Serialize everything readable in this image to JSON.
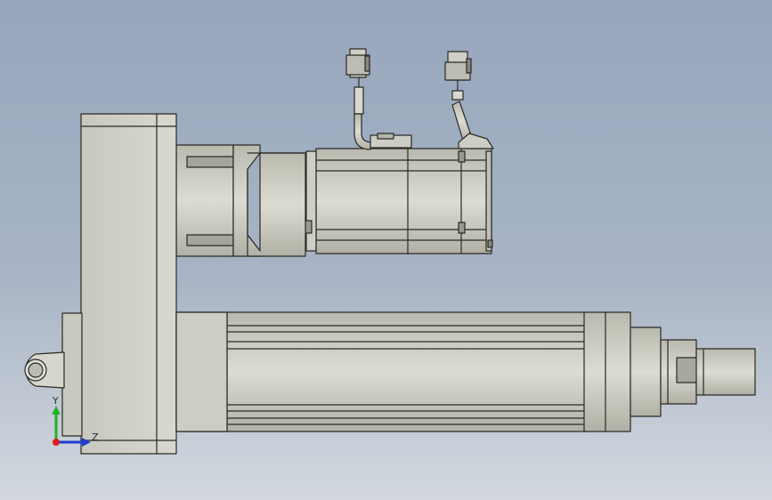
{
  "viewport": {
    "background_top": "#97a6bd",
    "background_bottom": "#d3d8df",
    "body_color": "#d2d2c8",
    "edge_color": "#2a2a26"
  },
  "triad": {
    "y_label": "Y",
    "z_label": "Z",
    "y_color": "#22b322",
    "z_color": "#1e3cd2",
    "x_color": "#e01e1e"
  },
  "parts": [
    "motor-housing",
    "gearbox-adapter",
    "belt-housing",
    "actuator-tube",
    "end-cap",
    "piston-rod",
    "mounting-clevis",
    "power-connector",
    "encoder-connector"
  ]
}
